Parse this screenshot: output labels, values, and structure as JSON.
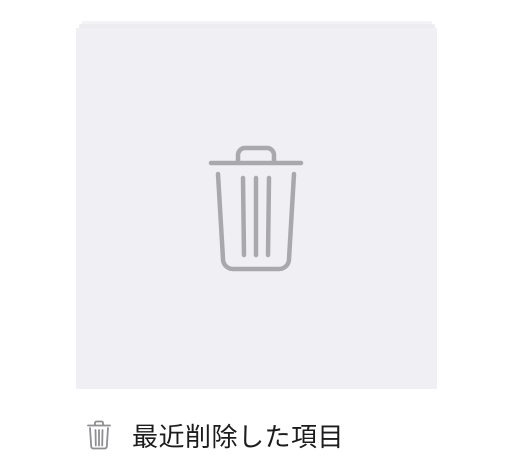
{
  "album": {
    "title": "最近削除した項目",
    "thumbnail_icon": "trash-icon",
    "label_icon": "trash-icon"
  },
  "colors": {
    "thumbnail_background": "#efeff4",
    "icon_gray": "#a9a9ad",
    "label_text": "#1c1c1e"
  }
}
